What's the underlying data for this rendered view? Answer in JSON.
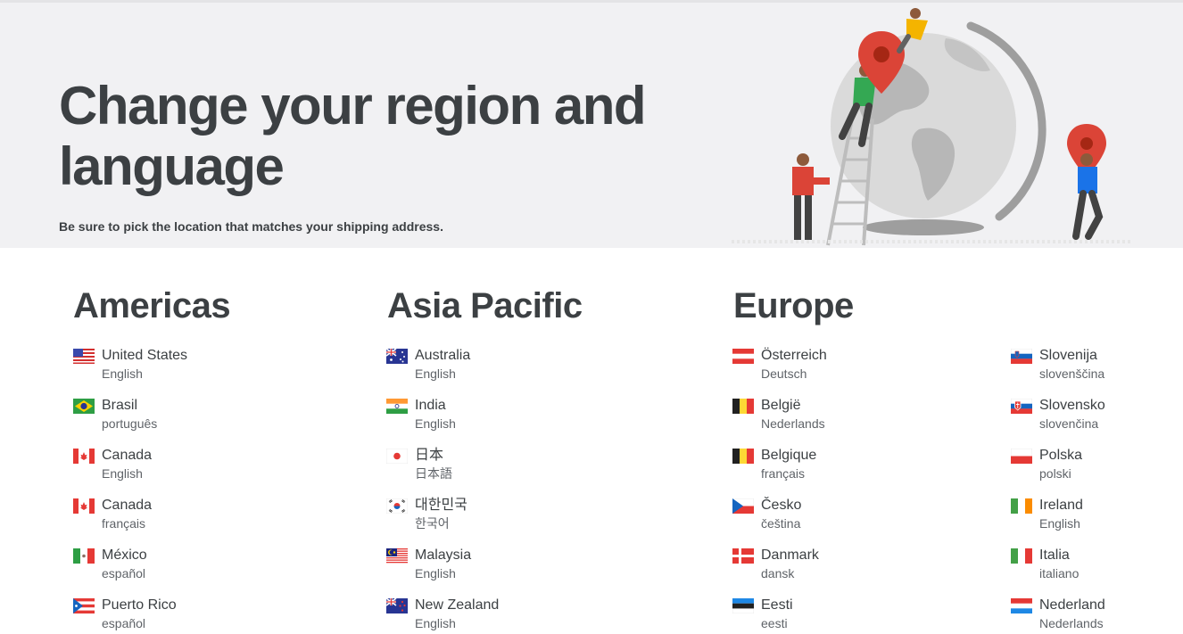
{
  "hero": {
    "title": "Change your region and language",
    "subtitle": "Be sure to pick the location that matches your shipping address."
  },
  "columns": [
    {
      "title": "Americas",
      "items": [
        {
          "country": "United States",
          "language": "English",
          "flag": "us-flag-icon"
        },
        {
          "country": "Brasil",
          "language": "português",
          "flag": "brazil-flag-icon"
        },
        {
          "country": "Canada",
          "language": "English",
          "flag": "canada-flag-icon"
        },
        {
          "country": "Canada",
          "language": "français",
          "flag": "canada-flag-icon"
        },
        {
          "country": "México",
          "language": "español",
          "flag": "mexico-flag-icon"
        },
        {
          "country": "Puerto Rico",
          "language": "español",
          "flag": "puerto-rico-flag-icon"
        }
      ]
    },
    {
      "title": "Asia Pacific",
      "items": [
        {
          "country": "Australia",
          "language": "English",
          "flag": "australia-flag-icon"
        },
        {
          "country": "India",
          "language": "English",
          "flag": "india-flag-icon"
        },
        {
          "country": "日本",
          "language": "日本語",
          "flag": "japan-flag-icon"
        },
        {
          "country": "대한민국",
          "language": "한국어",
          "flag": "korea-flag-icon"
        },
        {
          "country": "Malaysia",
          "language": "English",
          "flag": "malaysia-flag-icon"
        },
        {
          "country": "New Zealand",
          "language": "English",
          "flag": "new-zealand-flag-icon"
        }
      ]
    },
    {
      "title": "Europe",
      "items": [
        {
          "country": "Österreich",
          "language": "Deutsch",
          "flag": "austria-flag-icon"
        },
        {
          "country": "België",
          "language": "Nederlands",
          "flag": "belgium-flag-icon"
        },
        {
          "country": "Belgique",
          "language": "français",
          "flag": "belgium-flag-icon"
        },
        {
          "country": "Česko",
          "language": "čeština",
          "flag": "czech-flag-icon"
        },
        {
          "country": "Danmark",
          "language": "dansk",
          "flag": "denmark-flag-icon"
        },
        {
          "country": "Eesti",
          "language": "eesti",
          "flag": "estonia-flag-icon"
        }
      ]
    },
    {
      "title": "",
      "items": [
        {
          "country": "Slovenija",
          "language": "slovenščina",
          "flag": "slovenia-flag-icon"
        },
        {
          "country": "Slovensko",
          "language": "slovenčina",
          "flag": "slovakia-flag-icon"
        },
        {
          "country": "Polska",
          "language": "polski",
          "flag": "poland-flag-icon"
        },
        {
          "country": "Ireland",
          "language": "English",
          "flag": "ireland-flag-icon"
        },
        {
          "country": "Italia",
          "language": "italiano",
          "flag": "italy-flag-icon"
        },
        {
          "country": "Nederland",
          "language": "Nederlands",
          "flag": "netherlands-flag-icon"
        }
      ]
    }
  ]
}
